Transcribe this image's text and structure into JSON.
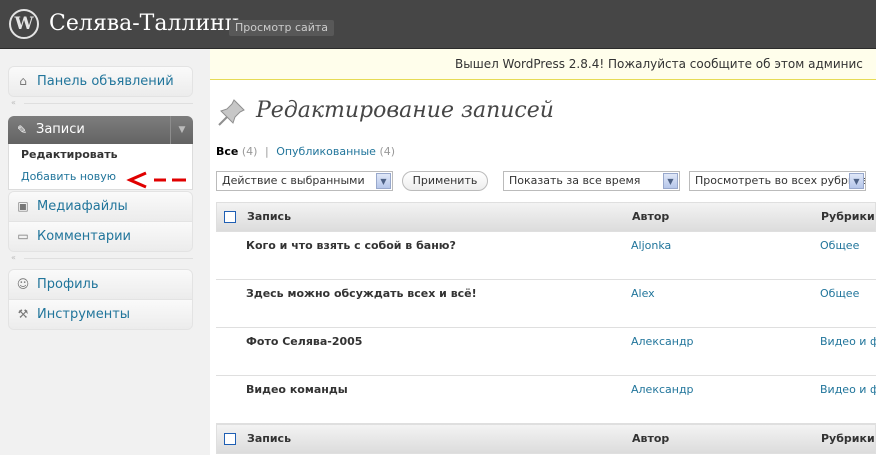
{
  "header": {
    "logo_letter": "W",
    "site_title": "Селява-Таллинн",
    "view_site": "Просмотр сайта"
  },
  "sidebar": {
    "dashboard": "Панель объявлений",
    "posts": {
      "label": "Записи",
      "sub": [
        "Редактировать",
        "Добавить новую"
      ]
    },
    "media": "Медиафайлы",
    "comments": "Комментарии",
    "profile": "Профиль",
    "tools": "Инструменты"
  },
  "notice": "Вышел WordPress 2.8.4! Пожалуйста сообщите об этом админис",
  "page_title": "Редактирование записей",
  "filters": {
    "all": "Все",
    "all_count": "(4)",
    "published": "Опубликованные",
    "published_count": "(4)"
  },
  "controls": {
    "bulk_action": "Действие с выбранными",
    "apply": "Применить",
    "date_filter": "Показать за все время",
    "category_filter": "Просмотреть во всех рубриках"
  },
  "table": {
    "columns": {
      "post": "Запись",
      "author": "Автор",
      "categories": "Рубрики"
    },
    "rows": [
      {
        "title": "Кого и что взять с собой в баню?",
        "author": "Aljonka",
        "category": "Общее"
      },
      {
        "title": "Здесь можно обсуждать всех и всё!",
        "author": "Alex",
        "category": "Общее"
      },
      {
        "title": "Фото Селява-2005",
        "author": "Александр",
        "category": "Видео и фото"
      },
      {
        "title": "Видео команды",
        "author": "Александр",
        "category": "Видео и фото"
      }
    ]
  },
  "colors": {
    "header": "#464646",
    "link": "#21759b",
    "annotation": "#e00000"
  }
}
